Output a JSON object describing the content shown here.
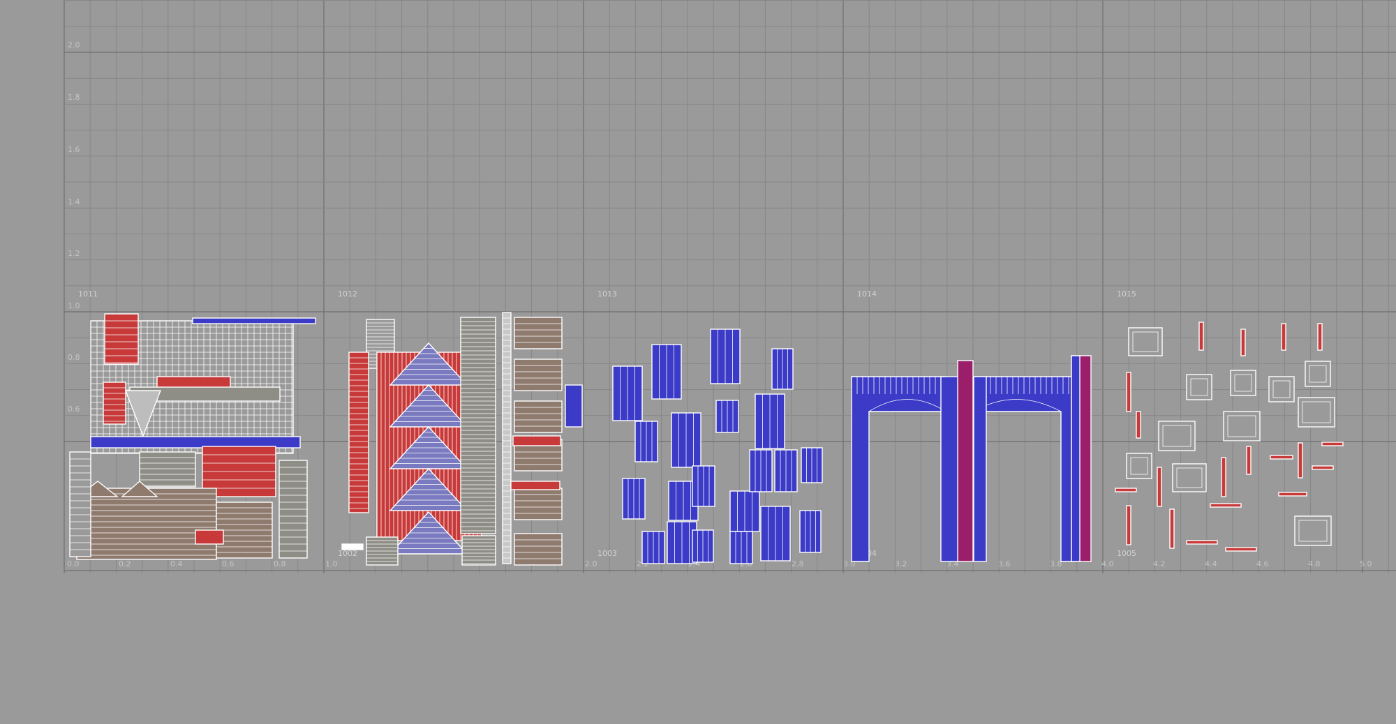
{
  "editor": {
    "title": ""
  },
  "v_axis_labels": [
    "2.0",
    "1.8",
    "1.6",
    "1.4",
    "1.2",
    "1.0",
    "0.8",
    "0.6"
  ],
  "u_axis_labels": [
    "0.0",
    "0.2",
    "0.4",
    "0.6",
    "0.8",
    "1.0",
    "2.0",
    "2.2",
    "2.4",
    "2.6",
    "2.8",
    "3.0",
    "3.2",
    "3.4",
    "3.6",
    "3.8",
    "4.0",
    "4.2",
    "4.4",
    "4.6",
    "4.8",
    "5.0"
  ],
  "udim_tiles": {
    "upper": [
      "1011",
      "1012",
      "1013",
      "1014",
      "1015"
    ],
    "lower": [
      "1002",
      "1003",
      "1004",
      "1005"
    ]
  },
  "colors": {
    "background": "#9a9a9a",
    "shell_blue": "#3b3bc8",
    "shell_red": "#c83a3a",
    "shell_magenta": "#9a1e6a",
    "shell_grey": "#8e8e86",
    "shell_brown": "#8f7a6e",
    "shell_outline": "#ffffff"
  }
}
